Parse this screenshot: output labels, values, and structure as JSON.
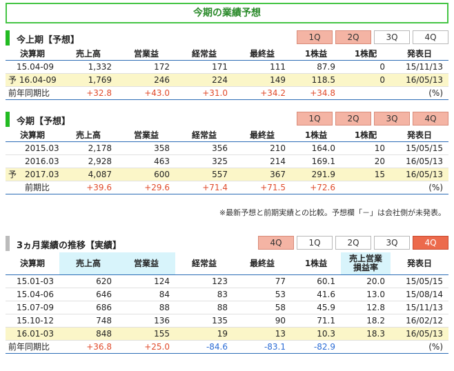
{
  "page_title": "今期の業績予想",
  "colors": {
    "green_bar": "#22bb22",
    "gray_bar": "#bbbbbb",
    "pos": "#e04a2a",
    "neg": "#2a6bd5",
    "highlight": "#fbf6c8"
  },
  "sections": [
    {
      "title": "今上期【予想】",
      "bar": "green",
      "tabs": [
        {
          "label": "1Q",
          "state": "salmon"
        },
        {
          "label": "2Q",
          "state": "salmon"
        },
        {
          "label": "3Q",
          "state": "white"
        },
        {
          "label": "4Q",
          "state": "white"
        }
      ],
      "headers": [
        "決算期",
        "売上高",
        "営業益",
        "経常益",
        "最終益",
        "1株益",
        "1株配",
        "発表日"
      ],
      "rows": [
        {
          "cells": [
            "　15.04-09",
            "1,332",
            "172",
            "171",
            "111",
            "87.9",
            "0",
            "15/11/13"
          ],
          "hl": false
        },
        {
          "cells": [
            "予 16.04-09",
            "1,769",
            "246",
            "224",
            "149",
            "118.5",
            "0",
            "16/05/13"
          ],
          "hl": true
        },
        {
          "cells": [
            "前年同期比",
            "+32.8",
            "+43.0",
            "+31.0",
            "+34.2",
            "+34.8",
            "",
            "(%)"
          ],
          "hl": false,
          "colored": true
        }
      ]
    },
    {
      "title": "今期【予想】",
      "bar": "green",
      "tabs": [
        {
          "label": "1Q",
          "state": "salmon"
        },
        {
          "label": "2Q",
          "state": "salmon"
        },
        {
          "label": "3Q",
          "state": "salmon"
        },
        {
          "label": "4Q",
          "state": "salmon"
        }
      ],
      "headers": [
        "決算期",
        "売上高",
        "営業益",
        "経常益",
        "最終益",
        "1株益",
        "1株配",
        "発表日"
      ],
      "rows": [
        {
          "cells": [
            "　　2015.03",
            "2,178",
            "358",
            "356",
            "210",
            "164.0",
            "10",
            "15/05/15"
          ],
          "hl": false
        },
        {
          "cells": [
            "　　2016.03",
            "2,928",
            "463",
            "325",
            "214",
            "169.1",
            "20",
            "16/05/13"
          ],
          "hl": false
        },
        {
          "cells": [
            "予　2017.03",
            "4,087",
            "600",
            "557",
            "367",
            "291.9",
            "15",
            "16/05/13"
          ],
          "hl": true
        },
        {
          "cells": [
            "　　前期比",
            "+39.6",
            "+29.6",
            "+71.4",
            "+71.5",
            "+72.6",
            "",
            "(%)"
          ],
          "hl": false,
          "colored": true
        }
      ],
      "note": "※最新予想と前期実績との比較。予想欄「－」は会社側が未発表。"
    },
    {
      "title": "3ヵ月業績の推移【実績】",
      "bar": "gray",
      "tabs": [
        {
          "label": "4Q",
          "state": "salmon"
        },
        {
          "label": "1Q",
          "state": "white"
        },
        {
          "label": "2Q",
          "state": "white"
        },
        {
          "label": "3Q",
          "state": "white"
        },
        {
          "label": "4Q",
          "state": "red"
        }
      ],
      "headers": [
        "決算期",
        "売上高",
        "営業益",
        "経常益",
        "最終益",
        "1株益",
        "売上営業\n損益率",
        "発表日"
      ],
      "rows": [
        {
          "cells": [
            "　15.01-03",
            "620",
            "124",
            "123",
            "77",
            "60.1",
            "20.0",
            "15/05/15"
          ],
          "hl": false
        },
        {
          "cells": [
            "　15.04-06",
            "646",
            "84",
            "83",
            "53",
            "41.6",
            "13.0",
            "15/08/14"
          ],
          "hl": false
        },
        {
          "cells": [
            "　15.07-09",
            "686",
            "88",
            "88",
            "58",
            "45.9",
            "12.8",
            "15/11/13"
          ],
          "hl": false
        },
        {
          "cells": [
            "　15.10-12",
            "748",
            "136",
            "135",
            "90",
            "71.1",
            "18.2",
            "16/02/12"
          ],
          "hl": false
        },
        {
          "cells": [
            "　16.01-03",
            "848",
            "155",
            "19",
            "13",
            "10.3",
            "18.3",
            "16/05/13"
          ],
          "hl": true
        },
        {
          "cells": [
            "前年同期比",
            "+36.8",
            "+25.0",
            "-84.6",
            "-83.1",
            "-82.9",
            "",
            "(%)"
          ],
          "hl": false,
          "colored": true
        }
      ]
    }
  ]
}
